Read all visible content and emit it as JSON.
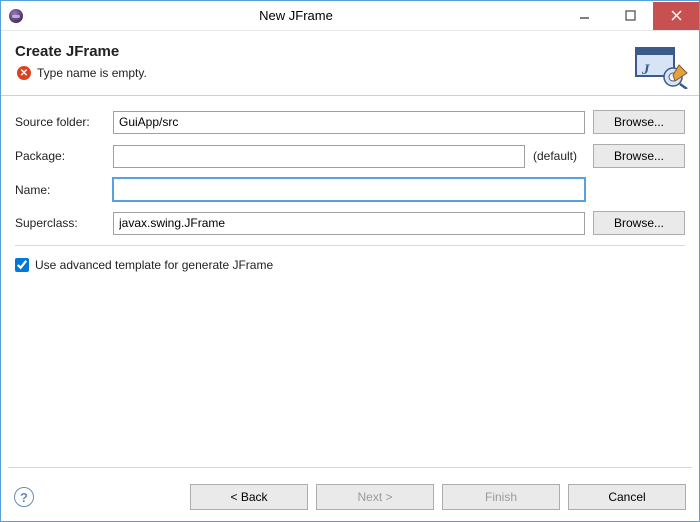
{
  "window": {
    "title": "New JFrame"
  },
  "header": {
    "title": "Create JFrame",
    "error_message": "Type name is empty."
  },
  "form": {
    "source_folder": {
      "label": "Source folder:",
      "value": "GuiApp/src",
      "browse": "Browse..."
    },
    "package": {
      "label": "Package:",
      "value": "",
      "suffix": "(default)",
      "browse": "Browse..."
    },
    "name": {
      "label": "Name:",
      "value": ""
    },
    "superclass": {
      "label": "Superclass:",
      "value": "javax.swing.JFrame",
      "browse": "Browse..."
    },
    "advanced_template": {
      "label": "Use advanced template for generate JFrame",
      "checked": true
    }
  },
  "footer": {
    "back": "< Back",
    "next": "Next >",
    "finish": "Finish",
    "cancel": "Cancel"
  }
}
